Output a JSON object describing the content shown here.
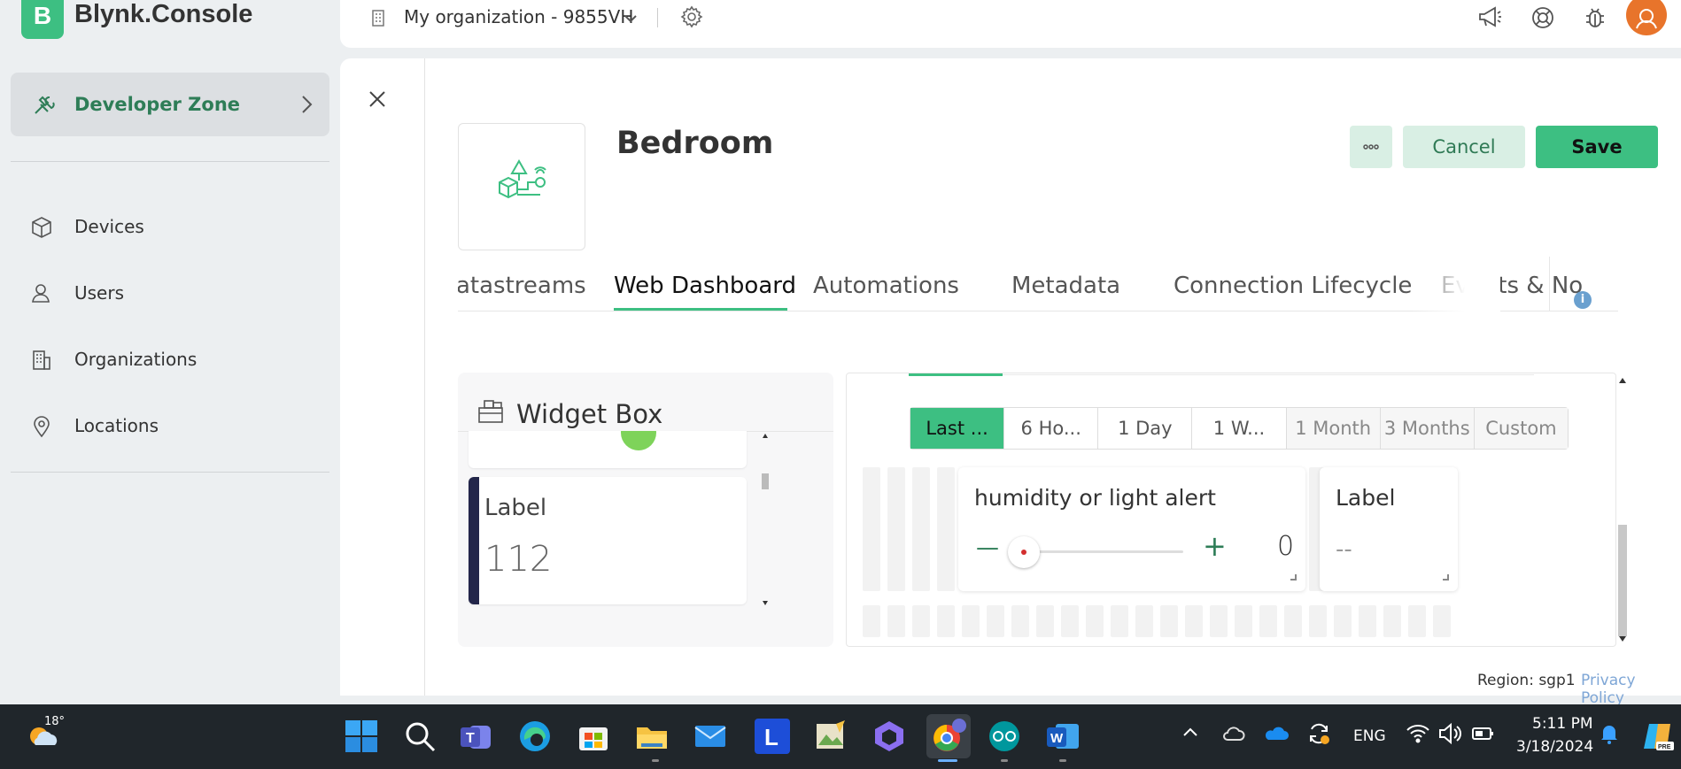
{
  "app": {
    "logo_letter": "B",
    "name": "Blynk.Console"
  },
  "topbar": {
    "org_name": "My organization - 9855VH"
  },
  "sidebar": {
    "developer_zone": "Developer Zone",
    "items": [
      {
        "label": "Devices",
        "icon": "cube-icon"
      },
      {
        "label": "Users",
        "icon": "users-icon"
      },
      {
        "label": "Organizations",
        "icon": "building-icon"
      },
      {
        "label": "Locations",
        "icon": "location-pin-icon"
      }
    ]
  },
  "template": {
    "title": "Bedroom",
    "cancel_label": "Cancel",
    "save_label": "Save",
    "tabs": [
      "atastreams",
      "Web Dashboard",
      "Automations",
      "Metadata",
      "Connection Lifecycle",
      "Events & No"
    ],
    "active_tab": "Web Dashboard"
  },
  "widget_box": {
    "title": "Widget Box",
    "card_label": "Label",
    "card_value": "112"
  },
  "dashboard": {
    "ranges": [
      "Last ...",
      "6 Ho...",
      "1 Day",
      "1 W...",
      "1 Month",
      "3 Months",
      "Custom"
    ],
    "active_range": "Last ...",
    "slider_widget": {
      "title": "humidity or light alert",
      "minus": "—",
      "plus": "+",
      "value": "0"
    },
    "label_widget": {
      "title": "Label",
      "value": "--"
    }
  },
  "footer": {
    "region": "Region: sgp1",
    "privacy": "Privacy Policy"
  },
  "taskbar": {
    "weather_temp": "18°",
    "language": "ENG",
    "time": "5:11 PM",
    "date": "3/18/2024",
    "colors": {
      "bg": "#20262b"
    }
  },
  "colors": {
    "accent": "#3dbf82",
    "accent_light": "#d9efe4",
    "widget_dark": "#23264a"
  }
}
